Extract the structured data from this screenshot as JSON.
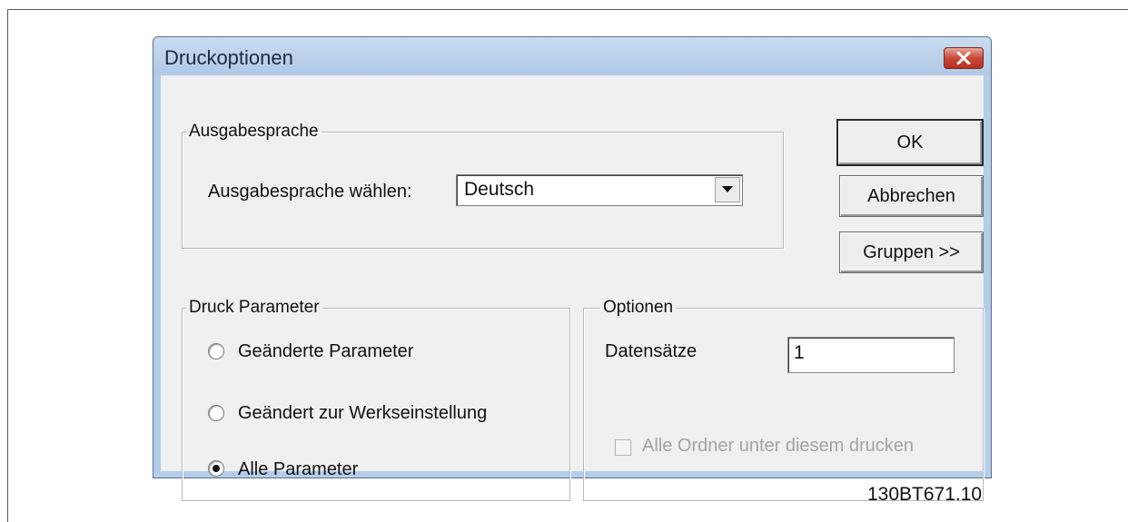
{
  "dialog": {
    "title": "Druckoptionen",
    "close_icon": "close-x-icon"
  },
  "output_language": {
    "group_label": "Ausgabesprache",
    "select_label": "Ausgabesprache wählen:",
    "selected_value": "Deutsch",
    "dropdown_icon": "chevron-down-icon"
  },
  "buttons": {
    "ok": "OK",
    "cancel": "Abbrechen",
    "groups": "Gruppen >>"
  },
  "print_parameters": {
    "group_label": "Druck Parameter",
    "options": [
      {
        "label": "Geänderte Parameter",
        "selected": false
      },
      {
        "label": "Geändert zur Werkseinstellung",
        "selected": false
      },
      {
        "label": "Alle Parameter",
        "selected": true
      }
    ]
  },
  "options": {
    "group_label": "Optionen",
    "records_label": "Datensätze",
    "records_value": "1",
    "checkbox_label": "Alle Ordner unter diesem drucken",
    "checkbox_checked": false,
    "checkbox_enabled": false
  },
  "figure_code": "130BT671.10",
  "colors": {
    "titlebar": "#b4cde8",
    "client_background": "#f0f0f0",
    "close_button": "#c9493a"
  }
}
